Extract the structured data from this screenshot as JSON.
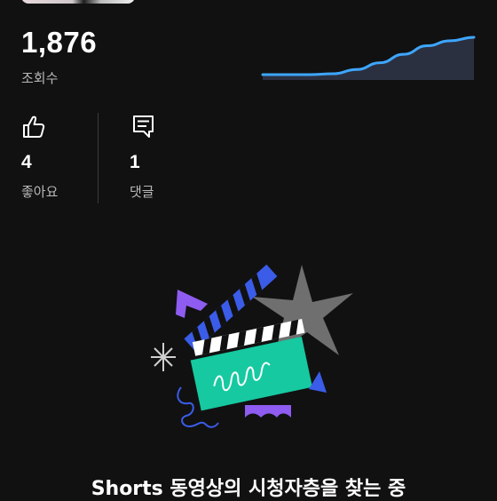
{
  "stats": {
    "views": {
      "value": "1,876",
      "label": "조회수"
    },
    "likes": {
      "value": "4",
      "label": "좋아요",
      "icon": "thumbs-up-icon"
    },
    "comments": {
      "value": "1",
      "label": "댓글",
      "icon": "comment-icon"
    }
  },
  "views_trend": {
    "type": "area",
    "series": [
      {
        "values": [
          0,
          0,
          0,
          1,
          6,
          14,
          24,
          34,
          40,
          44
        ]
      }
    ],
    "colors": {
      "line": "#3ea6ff",
      "fill": "#2b3040"
    }
  },
  "audience_status": {
    "illustration": "clapperboard-illustration",
    "text": "Shorts 동영상의 시청자층을 찾는 중"
  },
  "colors": {
    "background": "#111111",
    "secondary_text": "#b8b8b8",
    "accent": "#3ea6ff"
  }
}
